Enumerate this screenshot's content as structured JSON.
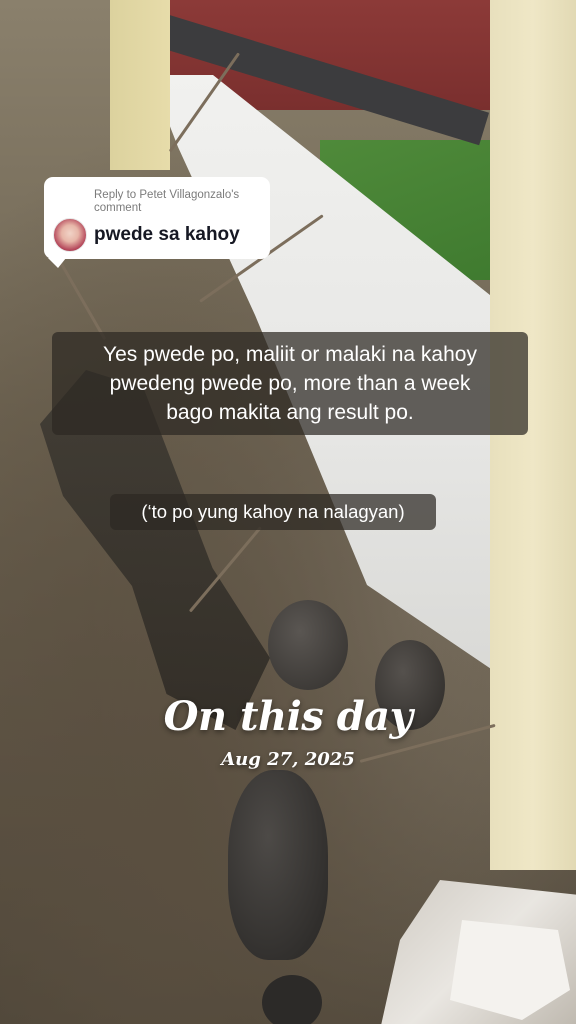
{
  "reply_card": {
    "reply_to": "Reply to Petet Villagonzalo's comment",
    "comment": "pwede sa kahoy",
    "avatar_icon": "user-avatar-icon"
  },
  "caption_main": {
    "line1": "Yes pwede po, maliit or malaki na kahoy",
    "line2": "pwedeng pwede po, more than a week",
    "line3": "bago makita ang result po."
  },
  "caption_sub": "(‘to po yung kahoy na nalagyan)",
  "on_this_day": {
    "title": "On this day",
    "date": "Aug 27, 2025"
  }
}
